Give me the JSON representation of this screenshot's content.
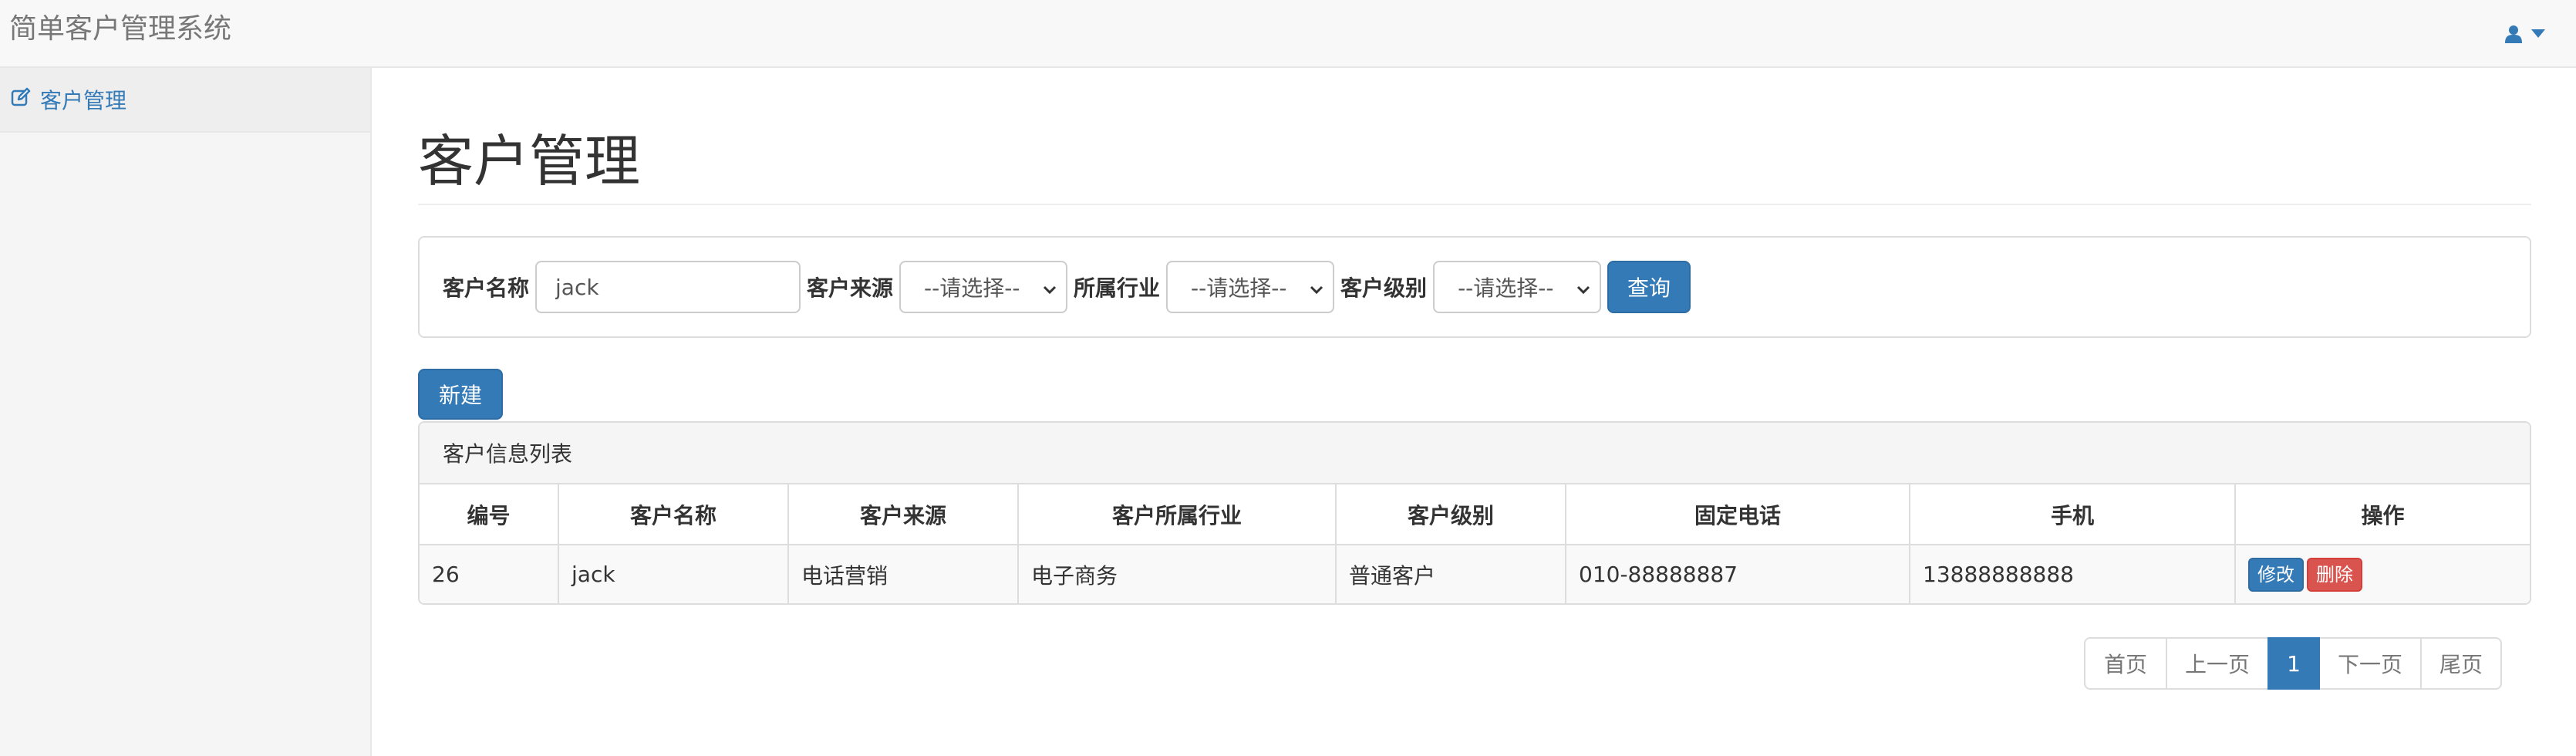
{
  "app": {
    "title": "简单客户管理系统"
  },
  "header": {
    "user_icon": "user-icon",
    "dropdown_icon": "caret-down-icon"
  },
  "sidebar": {
    "items": [
      {
        "label": "客户管理",
        "icon": "edit-icon"
      }
    ]
  },
  "main": {
    "title": "客户管理"
  },
  "search": {
    "name_label": "客户名称",
    "name_value": "jack",
    "source_label": "客户来源",
    "source_selected": "--请选择--",
    "industry_label": "所属行业",
    "industry_selected": "--请选择--",
    "level_label": "客户级别",
    "level_selected": "--请选择--",
    "query_label": "查询"
  },
  "new_button": "新建",
  "list": {
    "heading": "客户信息列表",
    "columns": [
      "编号",
      "客户名称",
      "客户来源",
      "客户所属行业",
      "客户级别",
      "固定电话",
      "手机",
      "操作"
    ],
    "rows": [
      {
        "id": "26",
        "name": "jack",
        "source": "电话营销",
        "industry": "电子商务",
        "level": "普通客户",
        "phone": "010-88888887",
        "mobile": "13888888888",
        "edit": "修改",
        "delete": "删除"
      }
    ]
  },
  "pagination": {
    "first": "首页",
    "prev": "上一页",
    "current": "1",
    "next": "下一页",
    "last": "尾页"
  },
  "colors": {
    "primary": "#337ab7",
    "danger": "#d9534f",
    "navbar_bg": "#f8f8f8",
    "sidebar_bg": "#f5f5f5"
  }
}
